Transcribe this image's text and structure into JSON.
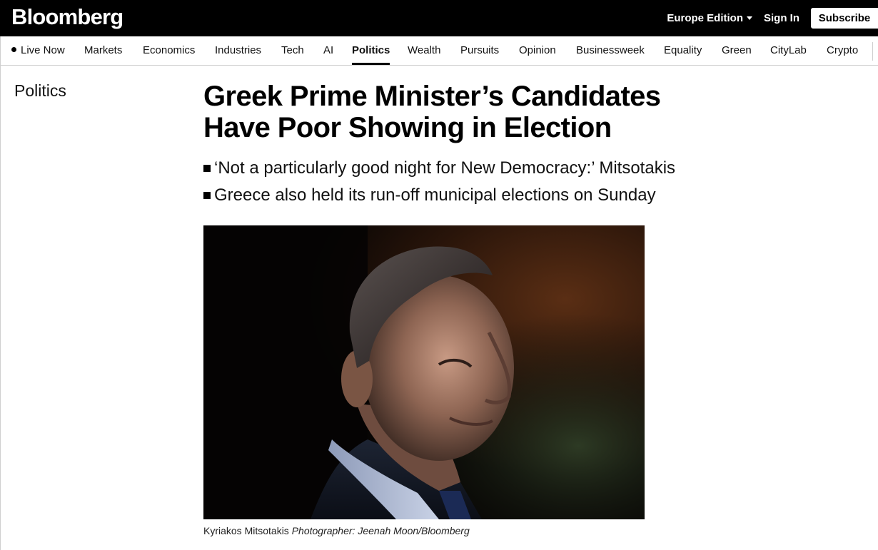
{
  "header": {
    "logo": "Bloomberg",
    "edition": "Europe Edition",
    "sign_in": "Sign In",
    "subscribe": "Subscribe"
  },
  "nav": {
    "items": [
      {
        "label": "Live Now",
        "live": true
      },
      {
        "label": "Markets"
      },
      {
        "label": "Economics"
      },
      {
        "label": "Industries"
      },
      {
        "label": "Tech"
      },
      {
        "label": "AI"
      },
      {
        "label": "Politics",
        "active": true
      },
      {
        "label": "Wealth"
      },
      {
        "label": "Pursuits"
      },
      {
        "label": "Opinion"
      },
      {
        "label": "Businessweek"
      },
      {
        "label": "Equality"
      },
      {
        "label": "Green"
      },
      {
        "label": "CityLab"
      },
      {
        "label": "Crypto"
      }
    ]
  },
  "article": {
    "section": "Politics",
    "headline_line1": "Greek Prime Minister’s Candidates",
    "headline_line2": "Have Poor Showing in Election",
    "bullets": [
      "‘Not a particularly good night for New Democracy:’ Mitsotakis",
      "Greece also held its run-off municipal elections on Sunday"
    ],
    "caption_name": "Kyriakos Mitsotakis",
    "caption_credit": "Photographer: Jeenah Moon/Bloomberg"
  },
  "colors": {
    "header_bg": "#000000",
    "accent": "#000000",
    "rule": "#cfcfcf"
  }
}
